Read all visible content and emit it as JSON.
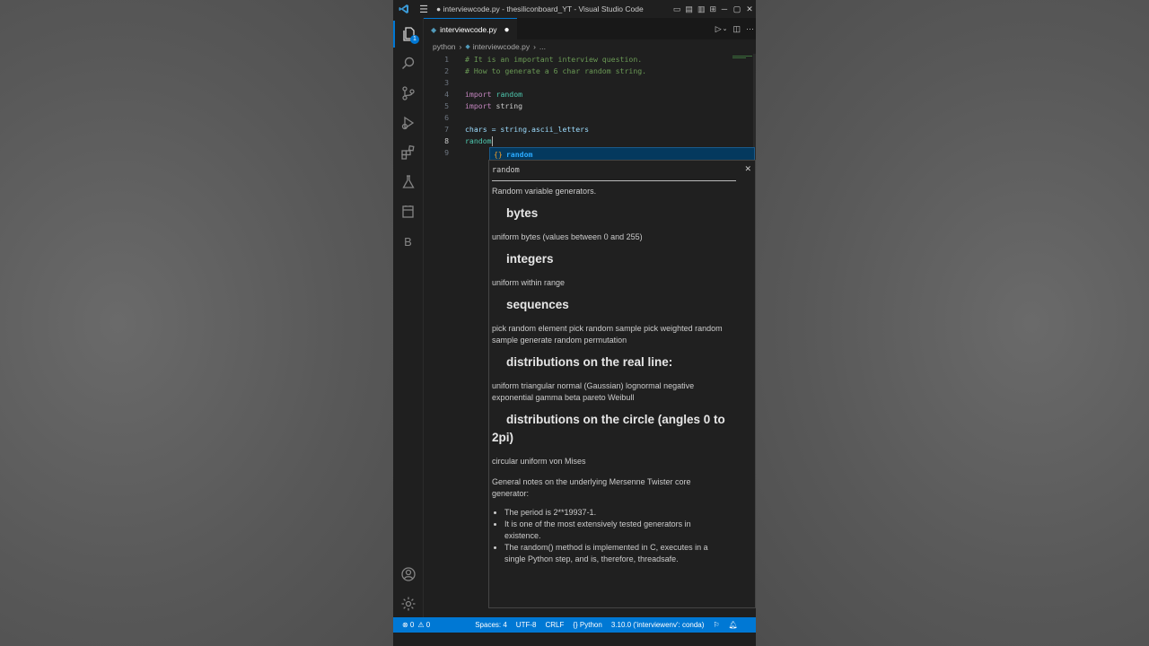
{
  "titlebar": {
    "title": "● interviewcode.py - thesiliconboard_YT - Visual Studio Code",
    "menu_icon": "hamburger-icon",
    "layout_icons": [
      "layout-panel-icon",
      "layout-sidebar-icon",
      "layout-editor-icon",
      "layout-custom-icon"
    ],
    "window_controls": [
      "─",
      "▢",
      "✕"
    ]
  },
  "activitybar": {
    "items": [
      "explorer-icon",
      "search-icon",
      "source-control-icon",
      "run-debug-icon",
      "extensions-icon",
      "testing-icon",
      "remote-explorer-icon",
      "b-extension-icon"
    ],
    "explorer_badge": "1",
    "b_label": "B",
    "bottom": [
      "accounts-icon",
      "settings-gear-icon"
    ]
  },
  "tab": {
    "filename": "interviewcode.py",
    "modified_dot": "●"
  },
  "breadcrumb": {
    "folder": "python",
    "file": "interviewcode.py",
    "more": "..."
  },
  "code": {
    "lines": [
      {
        "num": "1",
        "text": "# It is an important interview question."
      },
      {
        "num": "2",
        "text": "# How to generate a 6 char random string."
      },
      {
        "num": "3",
        "text": ""
      },
      {
        "num": "4",
        "kw": "import",
        "mod": "random"
      },
      {
        "num": "5",
        "kw": "import",
        "mod": "string"
      },
      {
        "num": "6",
        "text": ""
      },
      {
        "num": "7",
        "text": "chars = string.ascii_letters"
      },
      {
        "num": "8",
        "text": "random"
      },
      {
        "num": "9",
        "text": ""
      }
    ]
  },
  "suggest": {
    "symbol": "{}",
    "label": "random"
  },
  "doc": {
    "header": "random",
    "close": "✕",
    "intro": "Random variable generators.",
    "sections": [
      {
        "heading": "bytes",
        "text": "uniform bytes (values between 0 and 255)"
      },
      {
        "heading": "integers",
        "text": "uniform within range"
      },
      {
        "heading": "sequences",
        "text": "pick random element pick random sample pick weighted random sample generate random permutation"
      },
      {
        "heading": "distributions on the real line:",
        "text": "uniform triangular normal (Gaussian) lognormal negative exponential gamma beta pareto Weibull"
      },
      {
        "heading": "distributions on the circle (angles 0 to 2pi)",
        "text": "circular uniform von Mises"
      }
    ],
    "notes": "General notes on the underlying Mersenne Twister core generator:",
    "bullets": [
      "The period is 2**19937-1.",
      "It is one of the most extensively tested generators in existence.",
      "The random() method is implemented in C, executes in a single Python step, and is, therefore, threadsafe."
    ]
  },
  "statusbar": {
    "errors": "⊗ 0",
    "warnings": "⚠ 0",
    "spaces": "Spaces: 4",
    "encoding": "UTF-8",
    "eol": "CRLF",
    "language": "{} Python",
    "interpreter": "3.10.0 ('interviewenv': conda)",
    "bg_color": "#0078d4"
  }
}
